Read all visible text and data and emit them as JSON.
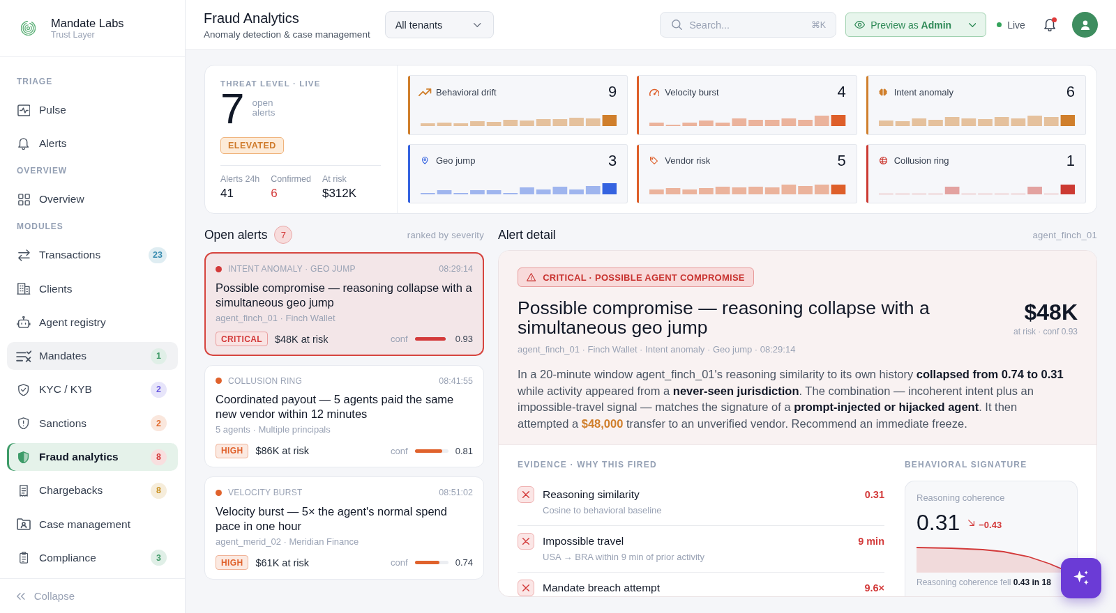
{
  "sidebar": {
    "brand": {
      "name": "Mandate Labs",
      "tagline": "Trust Layer"
    },
    "groups": [
      {
        "label": "TRIAGE",
        "items": [
          {
            "label": "Pulse",
            "selected": false,
            "hovered": false
          },
          {
            "label": "Alerts",
            "selected": false,
            "hovered": false
          }
        ]
      },
      {
        "label": "OVERVIEW",
        "items": [
          {
            "label": "Overview",
            "selected": false,
            "hovered": false
          }
        ]
      },
      {
        "label": "MODULES",
        "items": [
          {
            "label": "Transactions",
            "badge": "23",
            "color": "#3a8db0",
            "selected": false,
            "hovered": false
          },
          {
            "label": "Clients",
            "selected": false,
            "hovered": false
          },
          {
            "label": "Agent registry",
            "selected": false,
            "hovered": false
          },
          {
            "label": "Mandates",
            "badge": "1",
            "color": "#3f9a67",
            "selected": false,
            "hovered": true
          },
          {
            "label": "KYC / KYB",
            "badge": "2",
            "color": "#6a5ae0",
            "selected": false,
            "hovered": false
          },
          {
            "label": "Sanctions",
            "badge": "2",
            "color": "#e06a2c",
            "selected": false,
            "hovered": false
          },
          {
            "label": "Fraud analytics",
            "badge": "8",
            "color": "#d33a3a",
            "selected": true,
            "hovered": false
          },
          {
            "label": "Chargebacks",
            "badge": "8",
            "color": "#c99020",
            "selected": false,
            "hovered": false
          },
          {
            "label": "Case management",
            "selected": false,
            "hovered": false
          },
          {
            "label": "Compliance",
            "badge": "3",
            "color": "#3f9a67",
            "selected": false,
            "hovered": false
          }
        ]
      }
    ],
    "collapse": "Collapse"
  },
  "topbar": {
    "title": "Fraud Analytics",
    "subtitle": "Anomaly detection & case management",
    "tenant_select": "All tenants",
    "search": {
      "placeholder": "Search...",
      "shortcut": "⌘K"
    },
    "preview_button": "Preview as **Admin**",
    "status": "Live",
    "notifications_unread": true
  },
  "threat": {
    "label": "THREAT LEVEL · LIVE",
    "count": "7",
    "count_caption": "open alerts",
    "level": "ELEVATED",
    "stats": [
      {
        "label": "Alerts 24h",
        "value": "41",
        "color": "#111827"
      },
      {
        "label": "Confirmed",
        "value": "6",
        "color": "#d33a3a"
      },
      {
        "label": "At risk",
        "value": "$312K",
        "color": "#111827"
      }
    ]
  },
  "signals": [
    {
      "name": "Behavioral drift",
      "count": "9",
      "color": "#d07f2c"
    },
    {
      "name": "Velocity burst",
      "count": "4",
      "color": "#de5f2a"
    },
    {
      "name": "Intent anomaly",
      "count": "6",
      "color": "#d07f2c"
    },
    {
      "name": "Geo jump",
      "count": "3",
      "color": "#3563e0"
    },
    {
      "name": "Vendor risk",
      "count": "5",
      "color": "#de5f2a"
    },
    {
      "name": "Collusion ring",
      "count": "1",
      "color": "#cc3a32"
    }
  ],
  "open_alerts": {
    "title": "Open alerts",
    "count": "7",
    "note": "ranked by severity",
    "items": [
      {
        "category": "INTENT ANOMALY · GEO JUMP",
        "time": "08:29:14",
        "title": "Possible compromise — reasoning collapse with a simultaneous geo jump",
        "meta": "agent_finch_01 · Finch Wallet",
        "severity": "CRITICAL",
        "risk": "$48K at risk",
        "conf_label": "conf",
        "level": 0.93,
        "confidence": "0.93",
        "color": "#d33a3a",
        "selected": true
      },
      {
        "category": "COLLUSION RING",
        "time": "08:41:55",
        "title": "Coordinated payout — 5 agents paid the same new vendor within 12 minutes",
        "meta": "5 agents · Multiple principals",
        "severity": "HIGH",
        "risk": "$86K at risk",
        "conf_label": "conf",
        "level": 0.81,
        "confidence": "0.81",
        "color": "#e0622c",
        "selected": false
      },
      {
        "category": "VELOCITY BURST",
        "time": "08:51:02",
        "title": "Velocity burst — 5× the agent's normal spend pace in one hour",
        "meta": "agent_merid_02 · Meridian Finance",
        "severity": "HIGH",
        "risk": "$61K at risk",
        "conf_label": "conf",
        "level": 0.74,
        "confidence": "0.74",
        "color": "#e0622c",
        "selected": false
      }
    ]
  },
  "alert_detail": {
    "title": "Alert detail",
    "agent": "agent_finch_01",
    "banner": "CRITICAL · POSSIBLE AGENT COMPROMISE",
    "headline": "Possible compromise — reasoning collapse with a simultaneous geo jump",
    "amount": "$48K",
    "amount_caption": "at risk · conf 0.93",
    "meta": "agent_finch_01 · Finch Wallet · Intent anomaly · Geo jump · 08:29:14",
    "summary": [
      {
        "text": "In a 20-minute window agent_finch_01's reasoning similarity to its own history ",
        "kind": "plain"
      },
      {
        "text": "collapsed from 0.74 to 0.31",
        "kind": "strong"
      },
      {
        "text": " while activity appeared from a ",
        "kind": "plain"
      },
      {
        "text": "never-seen jurisdiction",
        "kind": "strong"
      },
      {
        "text": ". The combination — incoherent intent plus an impossible-travel signal — matches the signature of a ",
        "kind": "plain"
      },
      {
        "text": "prompt-injected or hijacked agent",
        "kind": "strong"
      },
      {
        "text": ". It then attempted a ",
        "kind": "plain"
      },
      {
        "text": "$48,000",
        "kind": "amount"
      },
      {
        "text": " transfer to an unverified vendor. Recommend an immediate freeze.",
        "kind": "plain"
      }
    ],
    "evidence": {
      "title": "EVIDENCE · WHY THIS FIRED",
      "items": [
        {
          "name": "Reasoning similarity",
          "detail": "Cosine to behavioral baseline",
          "value": "0.31"
        },
        {
          "name": "Impossible travel",
          "detail": "USA → BRA within 9 min of prior activity",
          "value": "9 min"
        },
        {
          "name": "Mandate breach attempt",
          "value": "9.6×"
        }
      ]
    },
    "signature": {
      "title": "BEHAVIORAL SIGNATURE",
      "metric": "Reasoning coherence",
      "value": "0.31",
      "delta": "−0.43",
      "caption": "Reasoning coherence fell **0.43 in 18**"
    }
  }
}
